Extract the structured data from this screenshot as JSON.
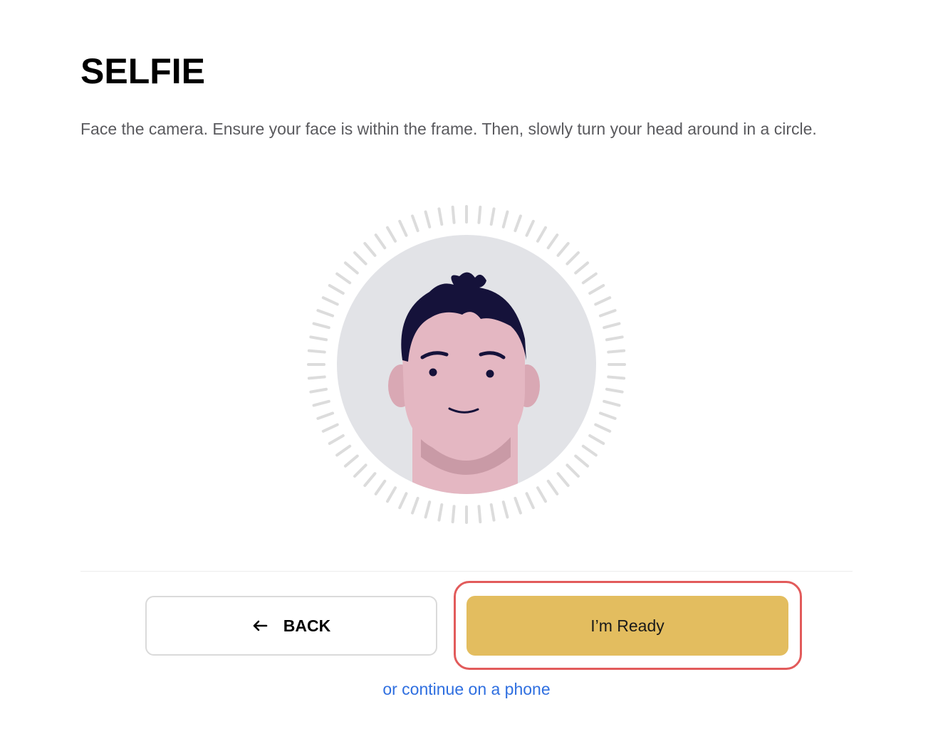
{
  "header": {
    "title": "SELFIE"
  },
  "main": {
    "instructions": "Face the camera. Ensure your face is within the frame. Then, slowly turn your head around in a circle.",
    "illustration": {
      "icon": "face-avatar-icon",
      "colors": {
        "background_circle": "#e2e3e7",
        "tick_marks": "#dcdcdc",
        "skin": "#e4b7c2",
        "skin_shadow": "#c99aa6",
        "hair": "#15123a"
      }
    }
  },
  "footer": {
    "back_label": "BACK",
    "back_icon": "arrow-left-icon",
    "ready_label": "I’m Ready",
    "phone_link": "or continue on a phone"
  },
  "colors": {
    "primary_button": "#e3bd5f",
    "highlight_border": "#e25b5b",
    "link": "#2f6fe0",
    "text_muted": "#5a5a5e"
  }
}
